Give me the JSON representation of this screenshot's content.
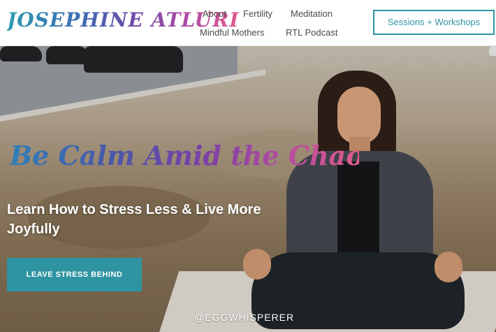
{
  "header": {
    "logo_text": "JOSEPHINE ATLURI",
    "nav": [
      "About",
      "Fertility",
      "Meditation",
      "Mindful Mothers",
      "RTL Podcast"
    ],
    "cta_label": "Sessions + Workshops"
  },
  "hero": {
    "tagline": "Be Calm Amid the Chaos",
    "headline": "Learn How to Stress Less & Live More Joyfully",
    "cta_label": "LEAVE STRESS BEHIND",
    "handle": "@EGGWHISPERER"
  },
  "colors": {
    "accent": "#2f94a2",
    "logo_gradient": [
      "#2f9bb2",
      "#6d4aa8",
      "#e25a8f"
    ]
  }
}
